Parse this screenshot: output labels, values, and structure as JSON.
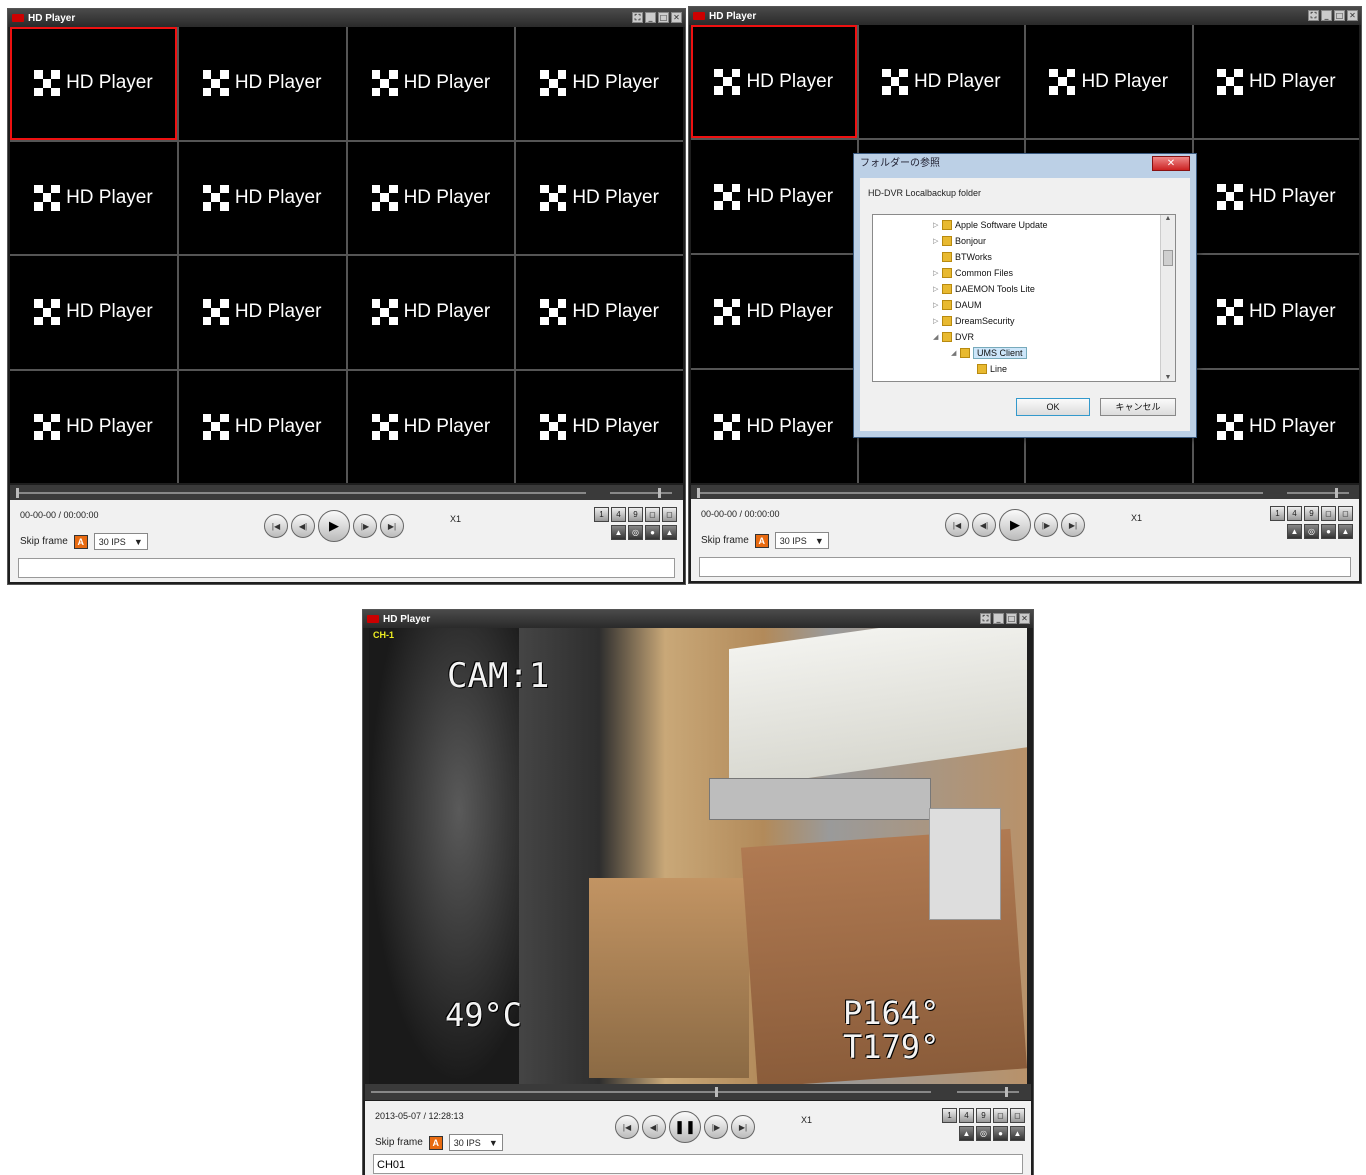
{
  "window_title": "HD Player",
  "cell_label": "HD Player",
  "windows": {
    "top_left": {
      "timecode": "00-00-00 / 00:00:00",
      "skip_label": "Skip frame",
      "skip_badge": "A",
      "fps_value": "30 IPS",
      "speed": "X1",
      "status_text": ""
    },
    "top_right": {
      "timecode": "00-00-00 / 00:00:00",
      "skip_label": "Skip frame",
      "skip_badge": "A",
      "fps_value": "30 IPS",
      "speed": "X1",
      "status_text": ""
    },
    "bottom": {
      "channel_label": "CH-1",
      "osd_cam": "CAM:1",
      "osd_temp": "49°C",
      "osd_pan": "P164°",
      "osd_tilt": "T179°",
      "timecode": "2013-05-07 / 12:28:13",
      "skip_label": "Skip frame",
      "skip_badge": "A",
      "fps_value": "30 IPS",
      "speed": "X1",
      "status_text": "CH01"
    }
  },
  "dialog": {
    "title": "フォルダーの参照",
    "description": "HD-DVR Localbackup folder",
    "close_label": "✕",
    "tree": [
      {
        "label": "Apple Software Update"
      },
      {
        "label": "Bonjour"
      },
      {
        "label": "BTWorks"
      },
      {
        "label": "Common Files"
      },
      {
        "label": "DAEMON Tools Lite"
      },
      {
        "label": "DAUM"
      },
      {
        "label": "DreamSecurity"
      },
      {
        "label": "DVR"
      },
      {
        "label": "UMS Client"
      },
      {
        "label": "Line"
      }
    ],
    "ok_label": "OK",
    "cancel_label": "キャンセル"
  },
  "icons": {
    "play": "play-icon",
    "pause": "pause-icon",
    "first": "skip-first-icon",
    "prev": "step-back-icon",
    "next": "step-forward-icon",
    "last": "skip-last-icon",
    "folder": "folder-icon"
  },
  "colors": {
    "selection": "#e11111",
    "fps_badge": "#e86a10",
    "dialog_close": "#cc2222"
  }
}
